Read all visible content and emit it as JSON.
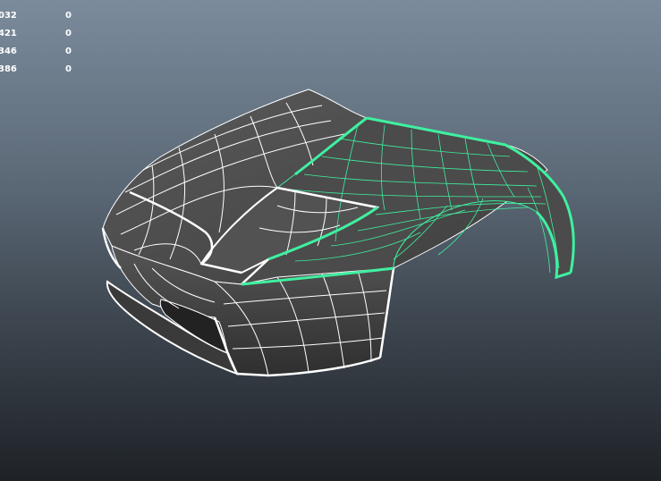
{
  "hud": {
    "rows": [
      {
        "label": "032",
        "value": "0"
      },
      {
        "label": "421",
        "value": "0"
      },
      {
        "label": "346",
        "value": "0"
      },
      {
        "label": "386",
        "value": "0"
      }
    ]
  },
  "colors": {
    "bg_top": "#7b8b9c",
    "bg_bottom": "#1e2227",
    "surface": "#4d4d4d",
    "wire": "#ffffff",
    "selection": "#3ff0a0"
  }
}
